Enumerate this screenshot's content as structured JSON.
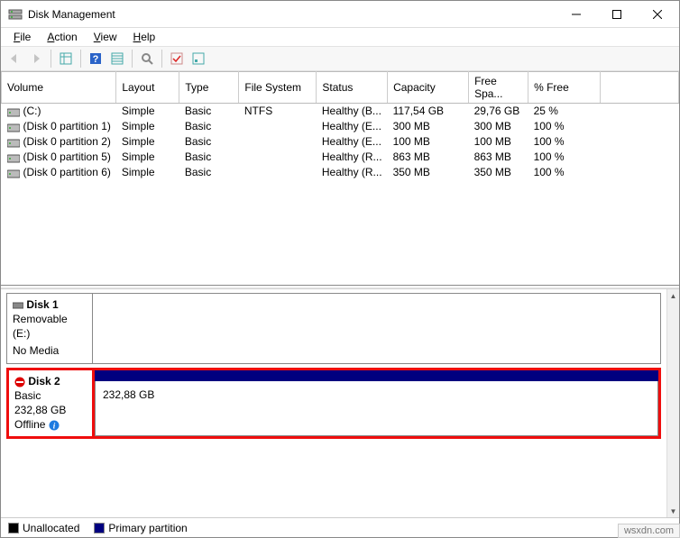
{
  "window": {
    "title": "Disk Management"
  },
  "menu": {
    "file": "File",
    "action": "Action",
    "view": "View",
    "help": "Help"
  },
  "columns": {
    "volume": "Volume",
    "layout": "Layout",
    "type": "Type",
    "fs": "File System",
    "status": "Status",
    "capacity": "Capacity",
    "free": "Free Spa...",
    "pctfree": "% Free"
  },
  "volumes": [
    {
      "name": "(C:)",
      "layout": "Simple",
      "type": "Basic",
      "fs": "NTFS",
      "status": "Healthy (B...",
      "capacity": "117,54 GB",
      "free": "29,76 GB",
      "pct": "25 %"
    },
    {
      "name": "(Disk 0 partition 1)",
      "layout": "Simple",
      "type": "Basic",
      "fs": "",
      "status": "Healthy (E...",
      "capacity": "300 MB",
      "free": "300 MB",
      "pct": "100 %"
    },
    {
      "name": "(Disk 0 partition 2)",
      "layout": "Simple",
      "type": "Basic",
      "fs": "",
      "status": "Healthy (E...",
      "capacity": "100 MB",
      "free": "100 MB",
      "pct": "100 %"
    },
    {
      "name": "(Disk 0 partition 5)",
      "layout": "Simple",
      "type": "Basic",
      "fs": "",
      "status": "Healthy (R...",
      "capacity": "863 MB",
      "free": "863 MB",
      "pct": "100 %"
    },
    {
      "name": "(Disk 0 partition 6)",
      "layout": "Simple",
      "type": "Basic",
      "fs": "",
      "status": "Healthy (R...",
      "capacity": "350 MB",
      "free": "350 MB",
      "pct": "100 %"
    }
  ],
  "disk1": {
    "name": "Disk 1",
    "type": "Removable (E:)",
    "media": "No Media"
  },
  "disk2": {
    "name": "Disk 2",
    "type": "Basic",
    "size": "232,88 GB",
    "state": "Offline",
    "partsize": "232,88 GB"
  },
  "legend": {
    "unalloc": "Unallocated",
    "primary": "Primary partition"
  },
  "watermark": "wsxdn.com"
}
